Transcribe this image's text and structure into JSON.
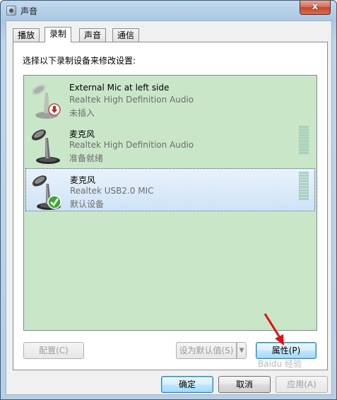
{
  "window": {
    "title": "声音",
    "close_label": "x",
    "app_icon": "speaker-icon"
  },
  "tabs": [
    {
      "label": "播放",
      "active": false
    },
    {
      "label": "录制",
      "active": true
    },
    {
      "label": "声音",
      "active": false
    },
    {
      "label": "通信",
      "active": false
    }
  ],
  "instruction": "选择以下录制设备来修改设置:",
  "devices": [
    {
      "name": "External Mic at left side",
      "driver": "Realtek High Definition Audio",
      "status": "未插入",
      "icon": "microphone-icon",
      "badge": "unplugged-badge-icon",
      "selected": false,
      "level_meter": false
    },
    {
      "name": "麦克风",
      "driver": "Realtek High Definition Audio",
      "status": "准备就绪",
      "icon": "microphone-icon",
      "badge": "",
      "selected": false,
      "level_meter": true
    },
    {
      "name": "麦克风",
      "driver": "Realtek USB2.0 MIC",
      "status": "默认设备",
      "icon": "microphone-icon",
      "badge": "default-check-icon",
      "selected": true,
      "level_meter": true
    }
  ],
  "buttons": {
    "configure": "配置(C)",
    "set_default": "设为默认值(S)",
    "properties": "属性(P)",
    "ok": "确定",
    "cancel": "取消",
    "apply": "应用(A)"
  },
  "watermark": "Baidu 经验",
  "colors": {
    "list_background": "#c9e6c9",
    "annotation_arrow": "#e01010"
  }
}
